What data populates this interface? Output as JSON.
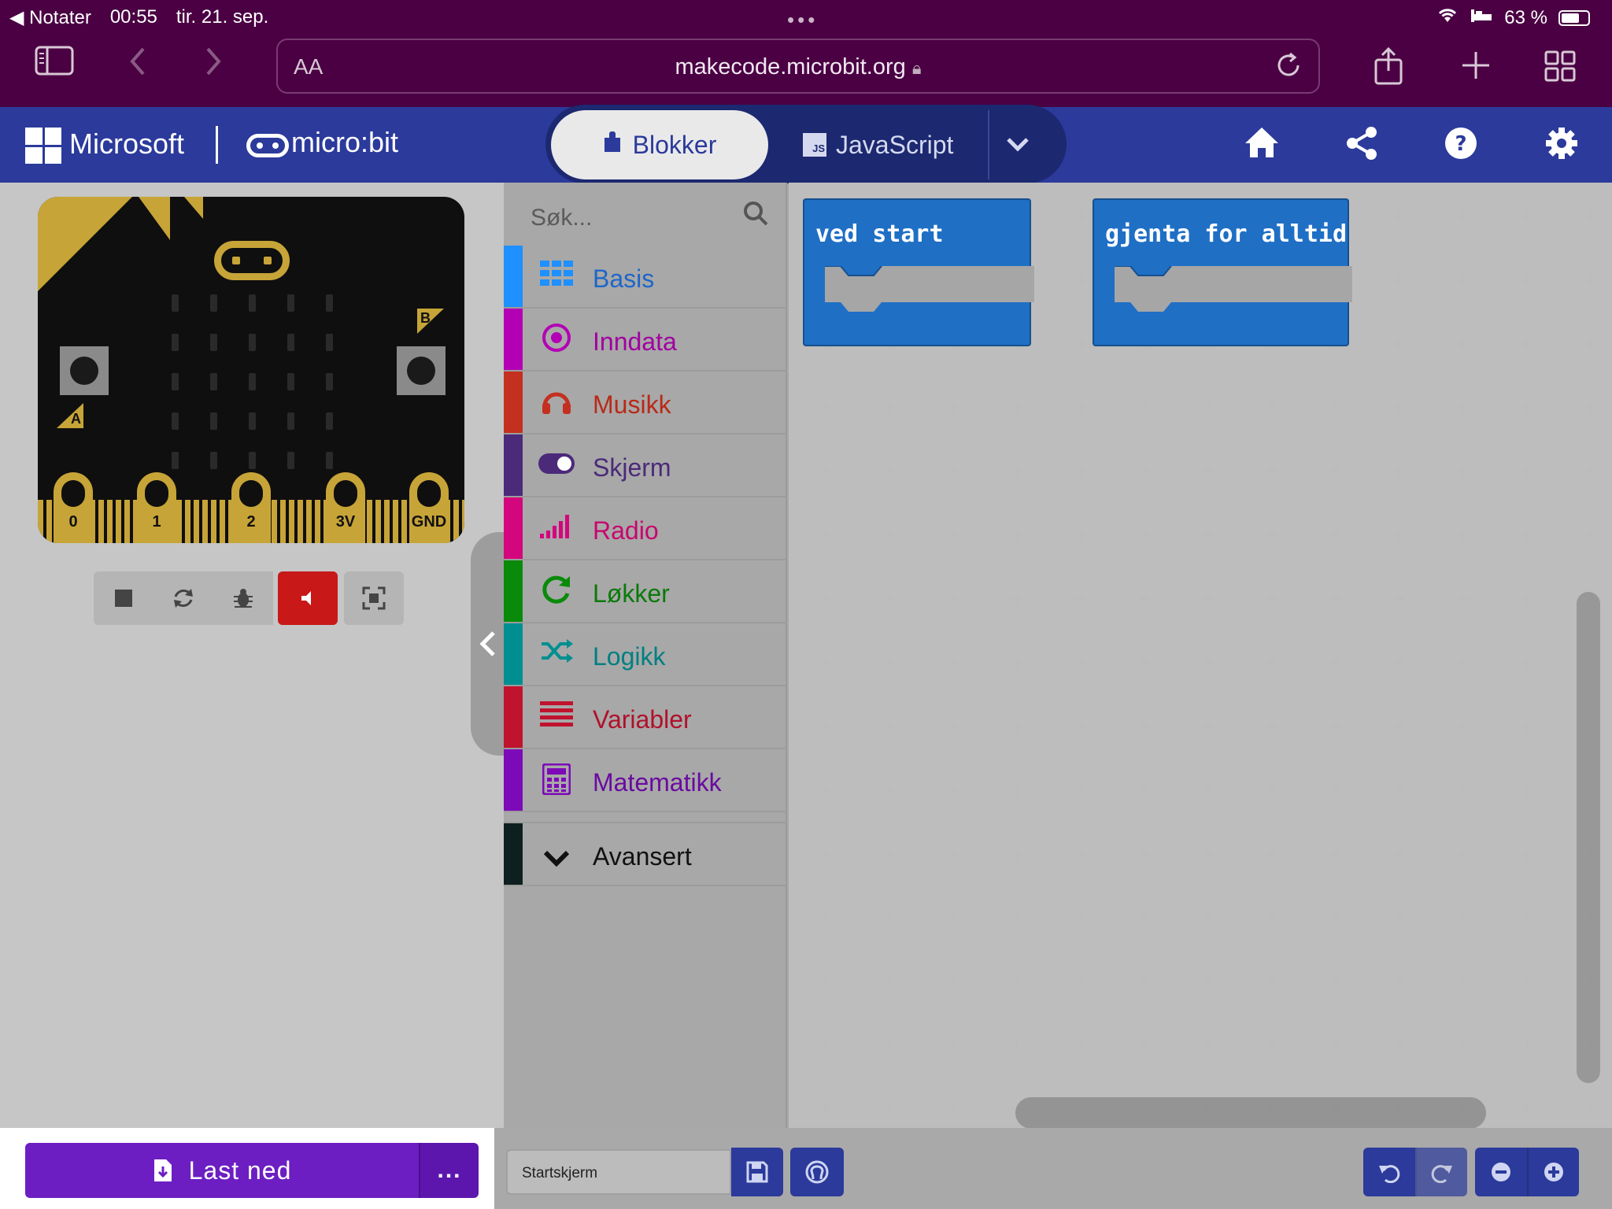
{
  "status_bar": {
    "back_app": "◀ Notater",
    "time": "00:55",
    "date": "tir. 21. sep.",
    "battery": "63 %"
  },
  "browser": {
    "aa": "AA",
    "url": "makecode.microbit.org"
  },
  "header": {
    "microsoft": "Microsoft",
    "microbit": "micro:bit",
    "tab_blocks": "Blokker",
    "tab_js": "JavaScript",
    "js_badge": "JS"
  },
  "simulator": {
    "button_a": "A",
    "button_b": "B",
    "pins": [
      "0",
      "1",
      "2",
      "3V",
      "GND"
    ]
  },
  "toolbox": {
    "search_placeholder": "Søk...",
    "categories": [
      {
        "label": "Basis",
        "color": "#1e90ff",
        "icon": "grid-icon"
      },
      {
        "label": "Inndata",
        "color": "#d400d4",
        "icon": "target-icon"
      },
      {
        "label": "Musikk",
        "color": "#e63022",
        "icon": "headphones-icon"
      },
      {
        "label": "Skjerm",
        "color": "#5c2d91",
        "icon": "toggle-icon"
      },
      {
        "label": "Radio",
        "color": "#e3008c",
        "icon": "signal-icon"
      },
      {
        "label": "Løkker",
        "color": "#00aa00",
        "icon": "loop-icon"
      },
      {
        "label": "Logikk",
        "color": "#00a4a6",
        "icon": "shuffle-icon"
      },
      {
        "label": "Variabler",
        "color": "#dc143c",
        "icon": "lines-icon"
      },
      {
        "label": "Matematikk",
        "color": "#9400d3",
        "icon": "calculator-icon"
      }
    ],
    "advanced": "Avansert"
  },
  "workspace": {
    "blocks": [
      "ved start",
      "gjenta for alltid"
    ]
  },
  "bottom": {
    "download": "Last ned",
    "more": "...",
    "project_name": "Startskjerm"
  }
}
